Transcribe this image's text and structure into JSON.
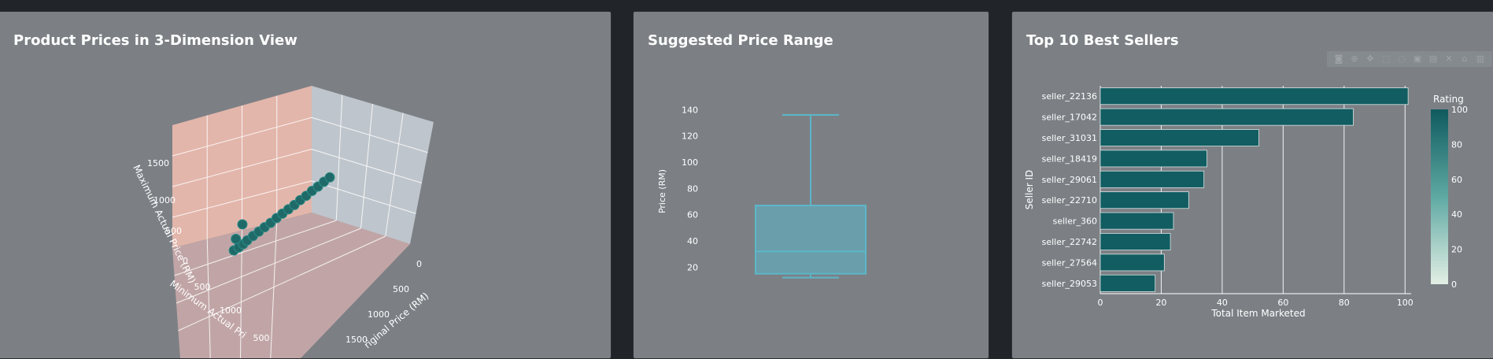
{
  "panels": {
    "scatter3d": {
      "title": "Product Prices in 3-Dimension View"
    },
    "box": {
      "title": "Suggested Price Range"
    },
    "bar": {
      "title": "Top 10 Best Sellers"
    }
  },
  "toolbar": {
    "buttons": [
      "camera-icon",
      "zoom-icon",
      "pan-icon",
      "box-select-icon",
      "lasso-icon",
      "zoom-in-icon",
      "zoom-out-icon",
      "autoscale-icon",
      "home-icon",
      "plotly-logo-icon"
    ]
  },
  "colors": {
    "page_bg": "#212428",
    "panel_bg": "#7c8085",
    "teal_dark": "#0e5a5e",
    "box_fill": "#6a9eab",
    "box_line": "#5bb7c8",
    "wall_pink": "#e9b8ad",
    "wall_grey": "#c3c8d0",
    "floor_pink": "#c9a9aa"
  },
  "chart_data": [
    {
      "type": "scatter3d",
      "title": "Product Prices in 3-Dimension View",
      "axes": {
        "z": {
          "label": "Maximum Actual Price (RM)",
          "ticks": [
            "0",
            "500",
            "1000",
            "1500"
          ]
        },
        "x": {
          "label": "Minimum Actual Pri",
          "ticks": [
            "500",
            "1000",
            "500"
          ]
        },
        "y": {
          "label": "riginal Price (RM)",
          "ticks": [
            "0",
            "500",
            "1000",
            "1500"
          ]
        }
      },
      "points": [
        {
          "x": 40,
          "y": 40,
          "z": 40
        },
        {
          "x": 80,
          "y": 80,
          "z": 60
        },
        {
          "x": 120,
          "y": 110,
          "z": 90
        },
        {
          "x": 150,
          "y": 160,
          "z": 140
        },
        {
          "x": 200,
          "y": 200,
          "z": 180
        },
        {
          "x": 250,
          "y": 240,
          "z": 220
        },
        {
          "x": 300,
          "y": 280,
          "z": 260
        },
        {
          "x": 350,
          "y": 330,
          "z": 300
        },
        {
          "x": 400,
          "y": 380,
          "z": 350
        },
        {
          "x": 450,
          "y": 420,
          "z": 390
        },
        {
          "x": 500,
          "y": 470,
          "z": 430
        },
        {
          "x": 550,
          "y": 520,
          "z": 470
        },
        {
          "x": 600,
          "y": 560,
          "z": 520
        },
        {
          "x": 650,
          "y": 610,
          "z": 560
        },
        {
          "x": 700,
          "y": 650,
          "z": 610
        },
        {
          "x": 750,
          "y": 700,
          "z": 650
        },
        {
          "x": 800,
          "y": 750,
          "z": 700
        },
        {
          "x": 850,
          "y": 790,
          "z": 740
        },
        {
          "x": 120,
          "y": 60,
          "z": 500
        },
        {
          "x": 60,
          "y": 40,
          "z": 260
        }
      ]
    },
    {
      "type": "box",
      "title": "Suggested Price Range",
      "ylabel": "Price (RM)",
      "yticks": [
        20,
        40,
        60,
        80,
        100,
        120,
        140
      ],
      "ylim": [
        10,
        145
      ],
      "stats": {
        "min": 12,
        "q1": 15,
        "median": 32,
        "q3": 67,
        "max": 136
      }
    },
    {
      "type": "bar",
      "orientation": "horizontal",
      "title": "Top 10 Best Sellers",
      "xlabel": "Total Item Marketed",
      "ylabel": "Seller ID",
      "xlim": [
        0,
        102
      ],
      "xticks": [
        0,
        20,
        40,
        60,
        80,
        100
      ],
      "categories": [
        "seller_22136",
        "seller_17042",
        "seller_31031",
        "seller_18419",
        "seller_29061",
        "seller_22710",
        "seller_360",
        "seller_22742",
        "seller_27564",
        "seller_29053"
      ],
      "values": [
        101,
        83,
        52,
        35,
        34,
        29,
        24,
        23,
        21,
        18
      ],
      "colorbar": {
        "title": "Rating",
        "ticks": [
          0,
          20,
          40,
          60,
          80,
          100
        ],
        "range": [
          0,
          100
        ]
      }
    }
  ]
}
